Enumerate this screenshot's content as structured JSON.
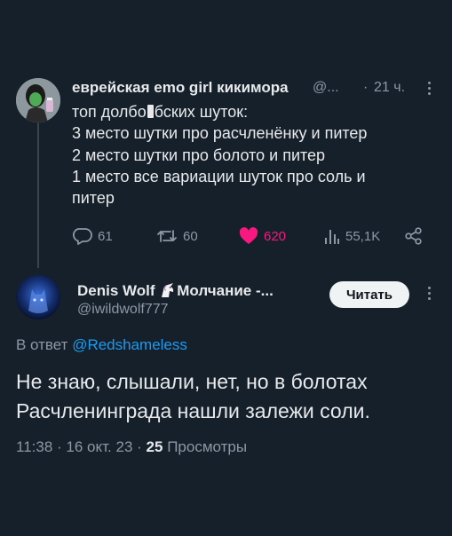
{
  "tweet1": {
    "display_name": "еврейская emo girl кикимора",
    "handle_truncated": "@...",
    "separator": "·",
    "time": "21 ч.",
    "text_line1_a": "топ долбо",
    "text_line1_b": "бских шуток:",
    "text_line2": "3 место шутки про расчленёнку и питер",
    "text_line3": "2 место шутки про болото и питер",
    "text_line4": "1 место все вариации шуток про соль и",
    "text_line5": "питер",
    "replies": "61",
    "retweets": "60",
    "likes": "620",
    "views": "55,1K",
    "like_color": "#f91880"
  },
  "tweet2": {
    "display_name_a": "Denis Wolf",
    "display_name_b": "Молчание -...",
    "handle": "@iwildwolf777",
    "follow_label": "Читать",
    "reply_prefix": "В ответ",
    "reply_handle": "@Redshameless",
    "text_line1": "Не знаю, слышали, нет, но в болотах",
    "text_line2": "Расчленинграда нашли залежи соли.",
    "time": "11:38",
    "sep1": "·",
    "date": "16 окт. 23",
    "sep2": "·",
    "views_count": "25",
    "views_label": "Просмотры"
  },
  "colors": {
    "background": "#15202b",
    "text": "#e7e9ea",
    "muted": "#8b98a5",
    "accent": "#1d9bf0"
  }
}
